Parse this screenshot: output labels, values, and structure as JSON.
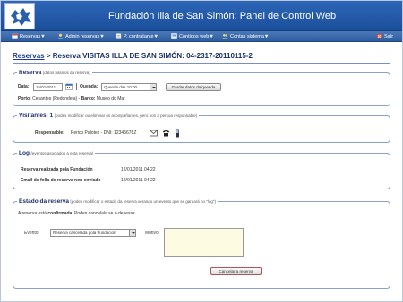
{
  "header": {
    "title": "Fundación Illa de San Simón: Panel de Control Web"
  },
  "menu": {
    "items": [
      {
        "label": "Reservas▼"
      },
      {
        "label": "Admin reservas▼"
      },
      {
        "label": "P. contratante▼"
      },
      {
        "label": "Contidos web▼"
      },
      {
        "label": "Contas sistema▼"
      }
    ],
    "exit": "Saír"
  },
  "breadcrumb": {
    "link": "Reservas",
    "separator": " > ",
    "current": "Reserva VISITAS ILLA DE SAN SIMÓN: 04-2317-20110115-2"
  },
  "reserva": {
    "legend": "Reserva",
    "hint": "(datos básicos da reserva)",
    "date_label": "Data:",
    "date_value": "15/01/2011",
    "queuda_label": "Quenda:",
    "queuda_value": "Quenda das 10:00",
    "save_button": "Gardar datos da/quenda",
    "porto_label": "Porto:",
    "porto_value": "Cesantes (Redondela)",
    "dash": "-",
    "barco_label": "Barco:",
    "barco_value": "Museo do Mar"
  },
  "visitantes": {
    "legend": "Visitantes: 1",
    "hint": "(podes modificar ou eliminar os acompañantes, pero non a persoa responsable)",
    "responsable_label": "Responsable:",
    "responsable_value": "Perico Palotes - DNI: 12345678Z"
  },
  "log": {
    "legend": "Log",
    "hint": "(eventos asociados a esta reserva)",
    "rows": [
      {
        "event": "Reserva realizada pola Fundación",
        "date": "12/01/2011 04:22"
      },
      {
        "event": "Email de folla de reserva non enviado",
        "date": "12/01/2011 04:22"
      }
    ]
  },
  "estado": {
    "legend": "Estado da reserva",
    "hint": "(podes modificar o estado da reserva xerando un evento que se gardará no \"log\")",
    "status_prefix": "A reserva está ",
    "status_value": "confirmada",
    "status_suffix": ". Podes cancelala se o desexas.",
    "evento_label": "Evento:",
    "evento_value": "Reserva cancelada pola Fundación",
    "motivo_label": "Motivo:",
    "cancel_button": "Cancelar a reserva"
  },
  "colors": {
    "header_blue": "#1b4f9b",
    "menu_blue": "#2e5da0",
    "accent_red": "#c0392b",
    "motivo_bg": "#fdfce3"
  }
}
